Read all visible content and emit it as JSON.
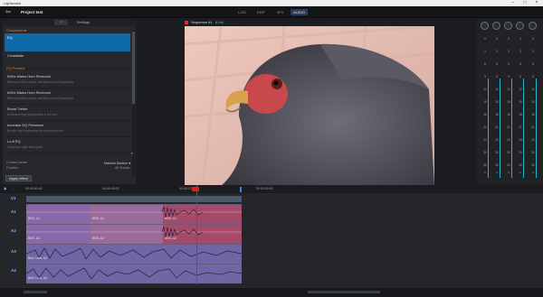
{
  "window": {
    "app_title": "Lightworks"
  },
  "topbar": {
    "project_name": "Project test",
    "modes": [
      "LOG",
      "EDIT",
      "VFX",
      "AUDIO"
    ],
    "active_mode": "AUDIO"
  },
  "left_panel": {
    "tabs": [
      "≡",
      "Settings"
    ],
    "components_header": "Components",
    "components": [
      "EQ",
      "Crossfade"
    ],
    "eq_presets_header": "EQ Presets",
    "presets": [
      {
        "title": "50Hz Mains Hum Removal",
        "desc": "Removes 50Hz mains interference and harmonics"
      },
      {
        "title": "60Hz Mains Hum Removal",
        "desc": "Removes 60Hz mains interference and harmonics"
      },
      {
        "title": "Boost Treble",
        "desc": "Enhances high frequencies in the mix"
      },
      {
        "title": "Increase EQ Presence",
        "desc": "Boosts mid frequencies for vocal presence"
      },
      {
        "title": "Lo-fi EQ",
        "desc": "Telephone style band-pass"
      }
    ],
    "footer_rows": [
      {
        "label": "Create preset",
        "value": "Marked Section ▾"
      },
      {
        "label": "Position",
        "value": "All Tracks"
      }
    ],
    "apply_label": "Apply effect"
  },
  "viewer": {
    "sequence_title": "Sequence #1",
    "sequence_tag": "(Edit)",
    "timecodes": [
      "00:00:00:00",
      "00:00:05:00",
      "00:00:10:00",
      "00:00:15:00",
      "00:00:20:00"
    ],
    "current_timecode": "00:00:11:07"
  },
  "mixer": {
    "labels": [
      "A1",
      "A2",
      "A3",
      "A4",
      "16"
    ],
    "scale": [
      "0",
      "3",
      "6",
      "9",
      "12",
      "15",
      "18",
      "21",
      "24",
      "30",
      "40",
      "∞"
    ]
  },
  "timeline": {
    "ruler": [
      "00:00:00:00",
      "00:00:05:00",
      "00:00:10:00",
      "00:00:15:00"
    ],
    "tracks": [
      "V1",
      "A1",
      "A2",
      "A3",
      "A4"
    ],
    "clips": [
      {
        "label": "BBS, A1"
      },
      {
        "label": "BBS, A1"
      },
      {
        "label": "BBS, A1"
      },
      {
        "label": "BBS, A2"
      },
      {
        "label": "BBS, A2"
      },
      {
        "label": "BBS, A2"
      },
      {
        "label": "Bird Calls, A3"
      },
      {
        "label": "Bird Calls, A4"
      }
    ]
  },
  "colors": {
    "accent": "#0f6aa7",
    "audio_clip": "#8a67a8",
    "clip_red": "#a44b6a",
    "playhead": "#e02020"
  }
}
